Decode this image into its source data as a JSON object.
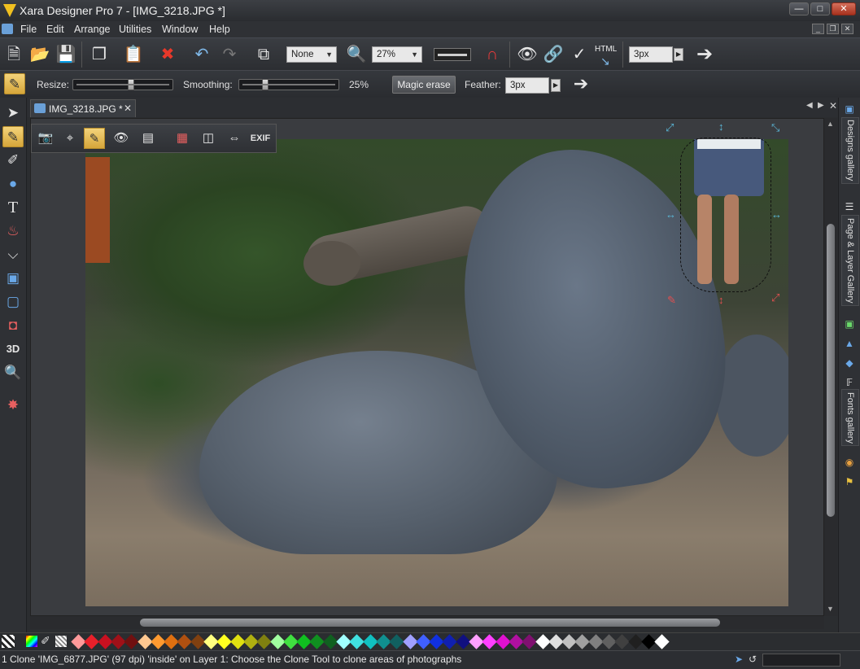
{
  "window": {
    "title": "Xara Designer Pro 7 - [IMG_3218.JPG *]"
  },
  "menu": [
    {
      "id": "file",
      "label": "File"
    },
    {
      "id": "edit",
      "label": "Edit"
    },
    {
      "id": "arrange",
      "label": "Arrange"
    },
    {
      "id": "utilities",
      "label": "Utilities"
    },
    {
      "id": "window",
      "label": "Window"
    },
    {
      "id": "help",
      "label": "Help"
    }
  ],
  "toolbar": {
    "quality_value": "None",
    "zoom_value": "27%",
    "html_label": "HTML",
    "line_width_value": "3px"
  },
  "infobar": {
    "resize_label": "Resize:",
    "smoothing_label": "Smoothing:",
    "smoothing_value": "25%",
    "magic_erase_label": "Magic erase",
    "feather_label": "Feather:",
    "feather_value": "3px",
    "resize_level": 0.6,
    "smoothing_level": 0.25
  },
  "document_tab": {
    "label": "IMG_3218.JPG *"
  },
  "photo_toolbar": {
    "exif_label": "EXIF"
  },
  "galleries": [
    {
      "id": "designs",
      "label": "Designs gallery"
    },
    {
      "id": "page-layer",
      "label": "Page & Layer Gallery"
    },
    {
      "id": "fonts",
      "label": "Fonts gallery"
    }
  ],
  "palette": [
    "#ff9a9a",
    "#e8202a",
    "#c81020",
    "#a01018",
    "#701010",
    "#ffc890",
    "#ff9a30",
    "#e07010",
    "#b05010",
    "#804010",
    "#ffff80",
    "#ffff20",
    "#e0e010",
    "#b0b010",
    "#808010",
    "#a0ffa0",
    "#40e040",
    "#10c020",
    "#109020",
    "#106020",
    "#a0ffff",
    "#40e0e0",
    "#10c0c0",
    "#109090",
    "#106060",
    "#a0a0ff",
    "#4060ff",
    "#1030e0",
    "#1020b0",
    "#101080",
    "#ffa0ff",
    "#ff40ff",
    "#e010d0",
    "#b010a0",
    "#801070",
    "#ffffff",
    "#e0e0e0",
    "#c0c0c0",
    "#a0a0a0",
    "#808080",
    "#606060",
    "#404040",
    "#202020",
    "#000000",
    "#ffffff"
  ],
  "status": {
    "text": "1 Clone 'IMG_6877.JPG' (97 dpi) 'inside' on Layer 1: Choose the Clone Tool to clone areas of photographs"
  }
}
